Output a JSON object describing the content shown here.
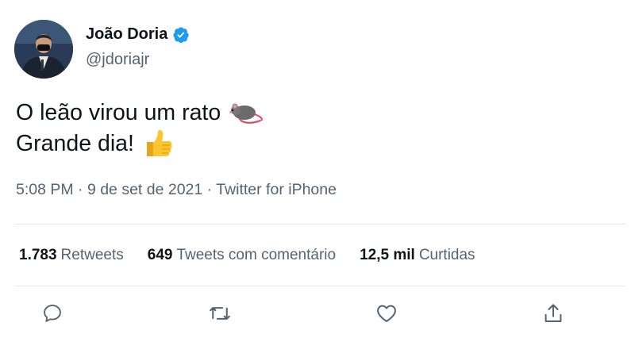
{
  "user": {
    "name": "João Doria",
    "handle": "@jdoriajr",
    "verified": true
  },
  "tweet": {
    "line1": "O leão virou um rato",
    "line1_emoji": "rat",
    "line2": "Grande dia!",
    "line2_emoji": "thumbs-up",
    "timestamp": "5:08 PM · 9 de set de 2021 · ",
    "source": "Twitter for iPhone"
  },
  "stats": {
    "retweets_count": "1.783",
    "retweets_label": "Retweets",
    "quotes_count": "649",
    "quotes_label": "Tweets com comentário",
    "likes_count": "12,5 mil",
    "likes_label": "Curtidas"
  },
  "colors": {
    "verified": "#1d9bf0",
    "secondary_text": "#536471",
    "icon": "#536471"
  },
  "icons": [
    "reply-icon",
    "retweet-icon",
    "like-icon",
    "share-icon"
  ]
}
